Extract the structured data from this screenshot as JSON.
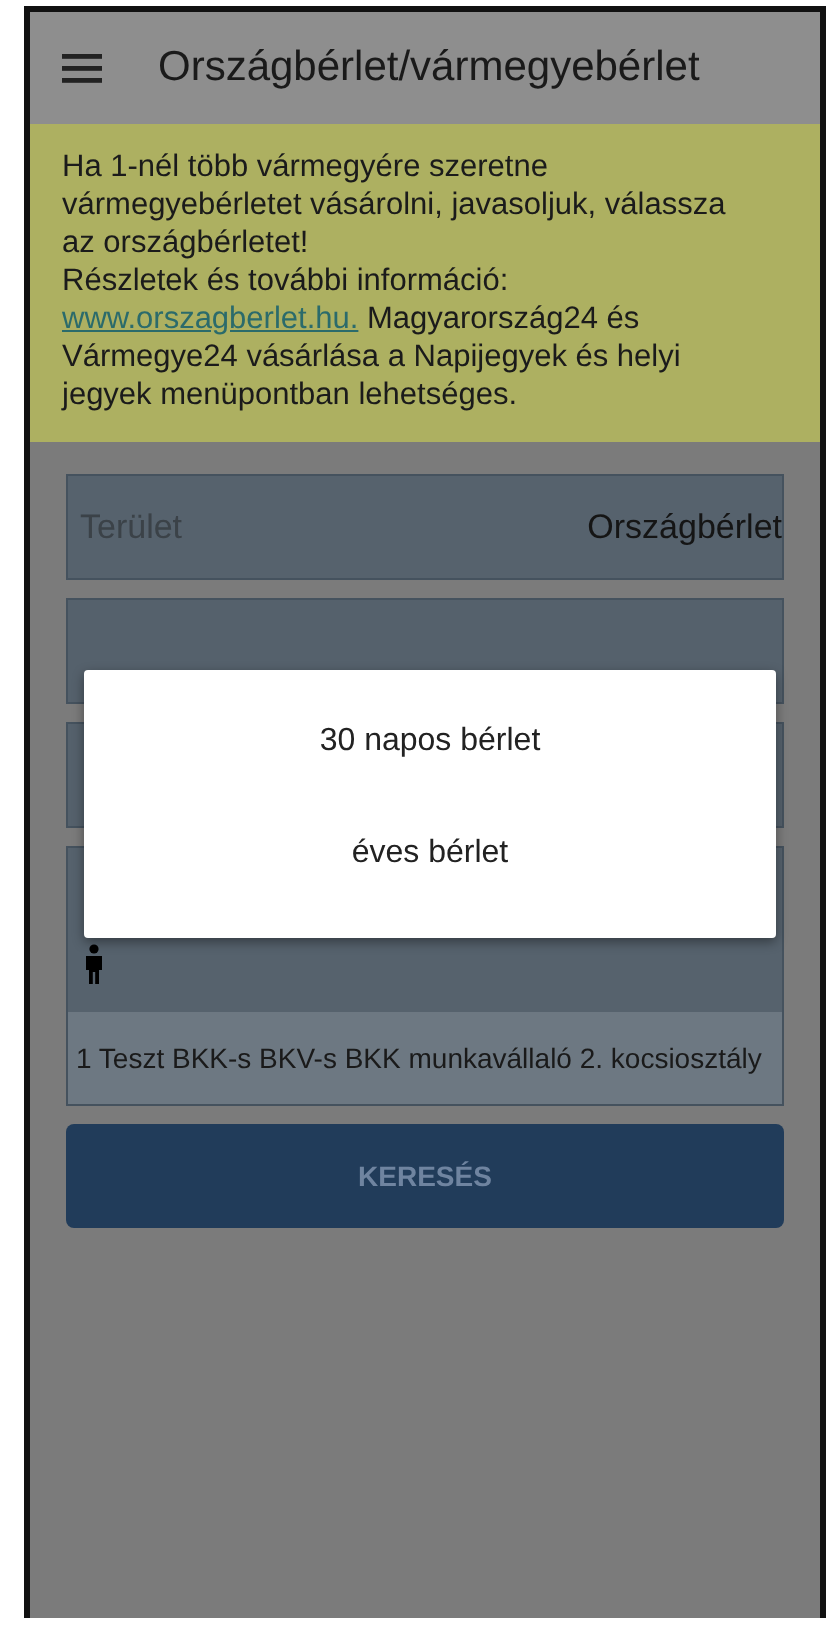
{
  "app_bar": {
    "title": "Országbérlet/vármegyebérlet"
  },
  "notice": {
    "text": "Ha 1-nél több vármegyére szeretne vármegyebérletet vásárolni, javasoljuk, válassza az országbérletet!\nRészletek és további információ:",
    "link": "www.orszagberlet.hu.",
    "after": "Magyarország24 és Vármegye24 vásárlása a Napijegyek és helyi jegyek menüpontban lehetséges."
  },
  "fields": [
    {
      "kind": "select",
      "label": "Terület",
      "value": "Országbérlet"
    },
    {
      "kind": "covered"
    },
    {
      "kind": "covered"
    }
  ],
  "passengers": [
    {
      "text": "1 Teszt BKK-s BKV-s   BKK munkavállaló 2. kocsiosztály"
    }
  ],
  "search_button": {
    "label": "KERESÉS"
  },
  "dialog": {
    "options": [
      {
        "label": "30 napos bérlet"
      },
      {
        "label": "éves bérlet"
      }
    ]
  }
}
